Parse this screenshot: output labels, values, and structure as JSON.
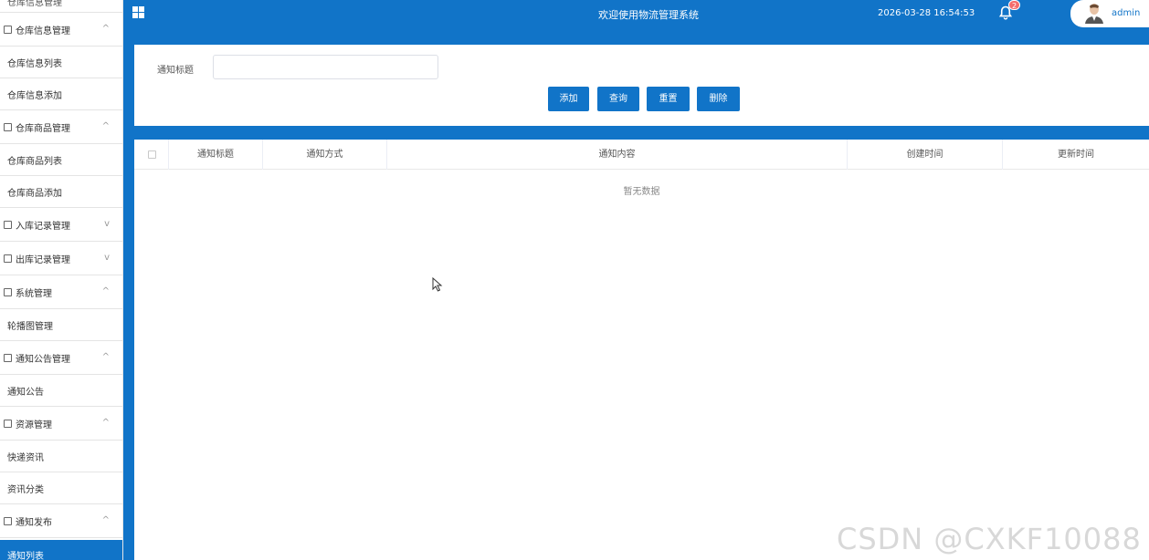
{
  "sidebar": {
    "cut_label": "仓库信息管理",
    "groups": [
      {
        "label": "仓库信息管理",
        "chevron": "^",
        "items": [
          "仓库信息列表",
          "仓库信息添加"
        ]
      },
      {
        "label": "仓库商品管理",
        "chevron": "^",
        "items": [
          "仓库商品列表",
          "仓库商品添加"
        ]
      },
      {
        "label": "入库记录管理",
        "chevron": "v",
        "items": []
      },
      {
        "label": "出库记录管理",
        "chevron": "v",
        "items": []
      },
      {
        "label": "系统管理",
        "chevron": "^",
        "items": [
          "轮播图管理"
        ]
      },
      {
        "label": "通知公告管理",
        "chevron": "^",
        "items": [
          "通知公告"
        ]
      },
      {
        "label": "资源管理",
        "chevron": "^",
        "items": [
          "快递资讯",
          "资讯分类"
        ]
      },
      {
        "label": "通知发布",
        "chevron": "^",
        "items": []
      }
    ],
    "active_item": "通知列表"
  },
  "header": {
    "title": "欢迎使用物流管理系统",
    "datetime": "2026-03-28 16:54:53",
    "notification_count": "2",
    "username": "admin"
  },
  "search": {
    "label": "通知标题",
    "value": "",
    "buttons": {
      "add": "添加",
      "query": "查询",
      "reset": "重置",
      "delete": "删除"
    }
  },
  "table": {
    "columns": [
      "通知标题",
      "通知方式",
      "通知内容",
      "创建时间",
      "更新时间"
    ],
    "empty_text": "暂无数据"
  },
  "watermark": "CSDN @CXKF10088",
  "colors": {
    "primary": "#1174c8",
    "badge": "#f56c6c"
  }
}
